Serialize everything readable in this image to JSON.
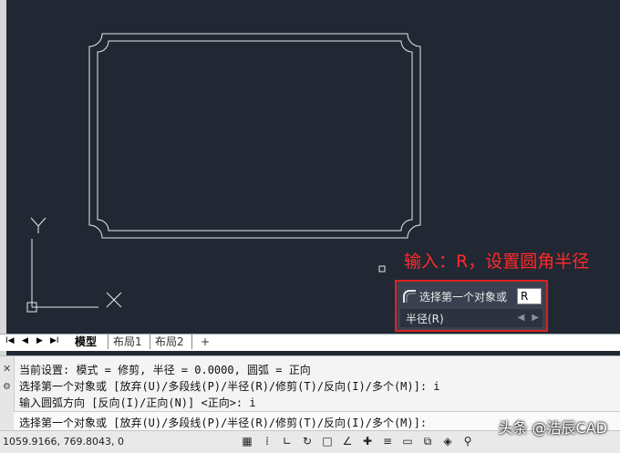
{
  "annotation": {
    "text": "输入：R，设置圆角半径"
  },
  "tooltip": {
    "prompt": "选择第一个对象或",
    "input_value": "R",
    "option": "半径(R)"
  },
  "layout_tabs": {
    "nav": [
      "I◀",
      "◀",
      "▶",
      "▶I"
    ],
    "tabs": [
      "模型",
      "布局1",
      "布局2",
      "+"
    ]
  },
  "command_history": [
    "当前设置: 模式 = 修剪, 半径 = 0.0000, 圆弧 = 正向",
    "选择第一个对象或 [放弃(U)/多段线(P)/半径(R)/修剪(T)/反向(I)/多个(M)]: i",
    "输入圆弧方向 [反向(I)/正向(N)] <正向>: i"
  ],
  "command_line": "选择第一个对象或 [放弃(U)/多段线(P)/半径(R)/修剪(T)/反向(I)/多个(M)]:",
  "status_bar": {
    "coords": "1059.9166, 769.8043, 0",
    "icons": [
      "grid-icon",
      "snap-icon",
      "ortho-icon",
      "polar-icon",
      "osnap-icon",
      "otrack-icon",
      "dyn-icon",
      "lineweight-icon",
      "transparency-icon",
      "selection-cycling-icon",
      "3d-osnap-icon",
      "annotation-icon"
    ]
  },
  "ucs": {
    "y_label": "Y",
    "x_label": "X"
  },
  "watermark": "头条 @浩辰CAD",
  "colors": {
    "canvas": "#212833",
    "annotation": "#ff2a2a",
    "highlight_border": "#e02020"
  }
}
